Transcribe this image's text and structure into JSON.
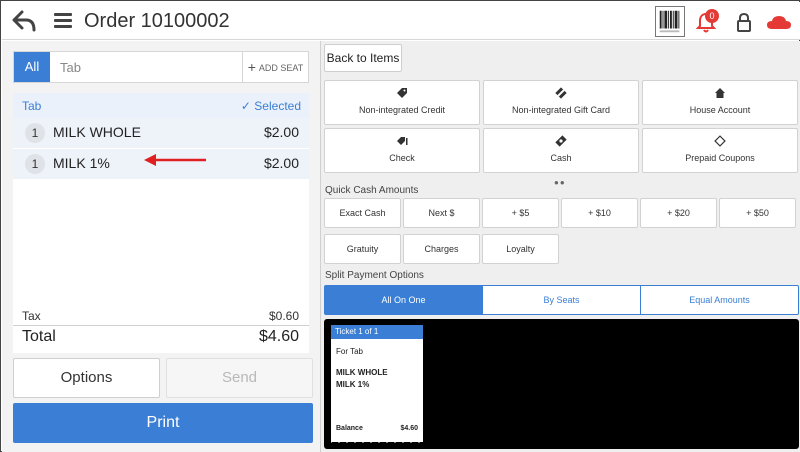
{
  "header": {
    "title": "Order 10100002",
    "notification_count": "0"
  },
  "tabbar": {
    "all_label": "All",
    "tab_label": "Tab",
    "add_seat_label": "ADD SEAT"
  },
  "items": {
    "header_tab": "Tab",
    "header_selected": "✓  Selected",
    "rows": [
      {
        "qty": "1",
        "name": "MILK WHOLE",
        "price": "$2.00"
      },
      {
        "qty": "1",
        "name": "MILK 1%",
        "price": "$2.00"
      }
    ]
  },
  "totals": {
    "tax_label": "Tax",
    "tax_value": "$0.60",
    "total_label": "Total",
    "total_value": "$4.60"
  },
  "buttons": {
    "options": "Options",
    "send": "Send",
    "print": "Print",
    "back_to_items": "Back to Items"
  },
  "payment_methods": [
    {
      "label": "Non-integrated Credit",
      "icon": "tag-icon"
    },
    {
      "label": "Non-integrated Gift Card",
      "icon": "gift-card-icon"
    },
    {
      "label": "House Account",
      "icon": "home-icon"
    },
    {
      "label": "Check",
      "icon": "check-icon"
    },
    {
      "label": "Cash",
      "icon": "cash-icon"
    },
    {
      "label": "Prepaid Coupons",
      "icon": "coupon-icon"
    }
  ],
  "quick_cash": {
    "title": "Quick Cash Amounts",
    "buttons": [
      "Exact Cash",
      "Next $",
      "+ $5",
      "+ $10",
      "+ $20",
      "+ $50",
      "Gratuity",
      "Charges",
      "Loyalty"
    ]
  },
  "split": {
    "title": "Split Payment Options",
    "options": [
      "All On One",
      "By Seats",
      "Equal Amounts"
    ],
    "active": "All On One"
  },
  "ticket": {
    "header": "Ticket 1 of 1",
    "for": "For Tab",
    "items": [
      "MILK WHOLE",
      "MILK 1%"
    ],
    "balance_label": "Balance",
    "balance_value": "$4.60"
  },
  "colors": {
    "accent": "#3a7fd5",
    "badge": "#e53935",
    "arrow": "#e02020",
    "cloud": "#e53935"
  }
}
